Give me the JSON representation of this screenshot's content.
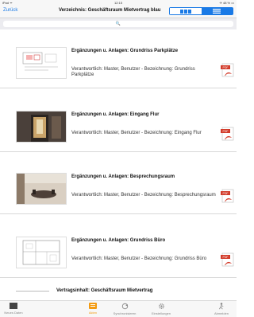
{
  "status_bar": {
    "left": "iPad ᯤ",
    "time": "12:15",
    "right": "✈ 48 % ▭"
  },
  "nav": {
    "back_label": "Zurück",
    "title": "Verzeichnis: Geschäftsraum Mietvertrag blau"
  },
  "search": {
    "placeholder": "🔍"
  },
  "colors": {
    "accent": "#1a7ae6",
    "pdf_red": "#d23b2a",
    "active_tab": "#f39b12"
  },
  "rows": [
    {
      "title": "Ergänzungen u. Anlagen: Grundriss Parkplätze",
      "subtitle": "Verantwortlich: Master, Benutzer - Bezeichnung: Grundriss Parkplätze",
      "thumb_icon": "floorplan-parking-thumbnail",
      "pdf_label": "PDF"
    },
    {
      "title": "Ergänzungen u. Anlagen: Eingang Flur",
      "subtitle": "Verantwortlich: Master, Benutzer - Bezeichnung: Eingang Flur",
      "thumb_icon": "entrance-photo-thumbnail",
      "pdf_label": "PDF"
    },
    {
      "title": "Ergänzungen u. Anlagen: Besprechungsraum",
      "subtitle": "Verantwortlich: Master, Benutzer - Bezeichnung: Besprechungsraum",
      "thumb_icon": "meeting-room-photo-thumbnail",
      "pdf_label": "PDF"
    },
    {
      "title": "Ergänzungen u. Anlagen: Grundriss Büro",
      "subtitle": "Verantwortlich: Master, Benutzer - Bezeichnung: Grundriss Büro",
      "thumb_icon": "floorplan-office-thumbnail",
      "pdf_label": "PDF"
    }
  ],
  "last_row": {
    "title": "Vertragsinhalt: Geschäftsraum Mietvertrag"
  },
  "tabs": [
    {
      "label": "Neues Daten",
      "icon": "folder-icon"
    },
    {
      "label": "Akten",
      "icon": "files-icon"
    },
    {
      "label": "Synchronisieren",
      "icon": "sync-icon"
    },
    {
      "label": "Einstellungen",
      "icon": "gear-icon"
    },
    {
      "label": "Abmelden",
      "icon": "person-exit-icon"
    }
  ]
}
